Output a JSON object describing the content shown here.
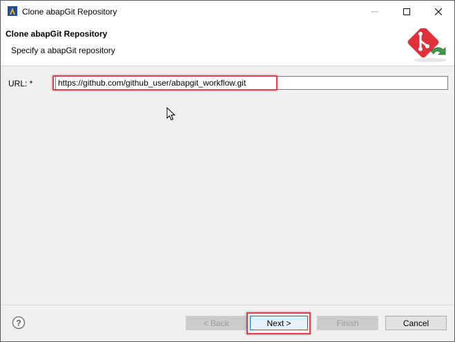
{
  "window": {
    "title": "Clone abapGit Repository",
    "icons": {
      "app": "eclipse-abap-icon",
      "minimize": "minimize-icon",
      "maximize": "maximize-icon",
      "close": "close-icon"
    }
  },
  "banner": {
    "title": "Clone abapGit Repository",
    "subtitle": "Specify a abapGit repository",
    "icon": "abapgit-clone-icon"
  },
  "form": {
    "url_label": "URL: *",
    "url_value": "https://github.com/github_user/abapgit_workflow.git"
  },
  "buttons": {
    "help_icon": "help-icon",
    "back": "< Back",
    "next": "Next >",
    "finish": "Finish",
    "cancel": "Cancel"
  },
  "colors": {
    "highlight": "#e0404a",
    "abapgit_red": "#e0303a",
    "arrow_green": "#3a9a4a"
  }
}
